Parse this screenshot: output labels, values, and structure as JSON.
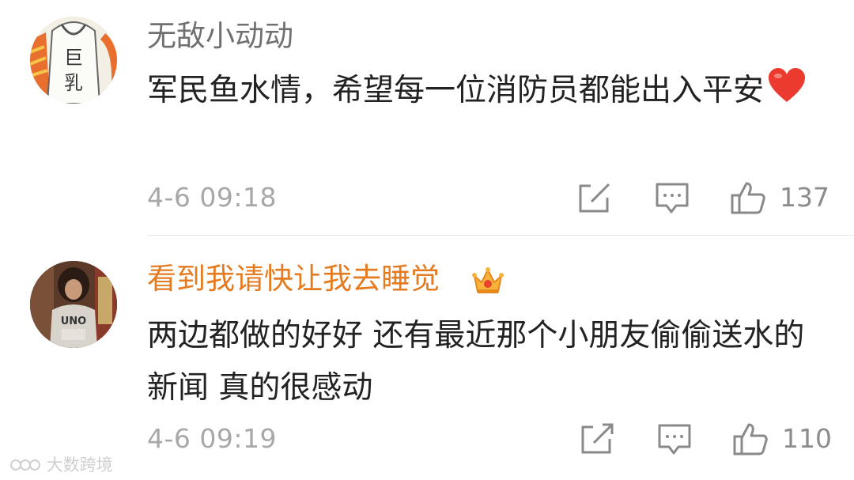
{
  "comments": [
    {
      "username": "无敌小动动",
      "avatar_text": "巨乳",
      "text": "军民鱼水情，希望每一位消防员都能出入平安",
      "emoji": "heart-emoji",
      "time": "4-6 09:18",
      "likes": "137"
    },
    {
      "username": "看到我请快让我去睡觉",
      "badge": "crown-badge",
      "avatar_text": "UNO",
      "text": "两边都做的好好 还有最近那个小朋友偷偷送水的新闻 真的很感动",
      "time": "4-6 09:19",
      "likes": "110"
    }
  ],
  "watermark": "大数跨境",
  "colors": {
    "username_vip": "#e57b21",
    "username": "#707070",
    "meta": "#a8a8a8"
  }
}
